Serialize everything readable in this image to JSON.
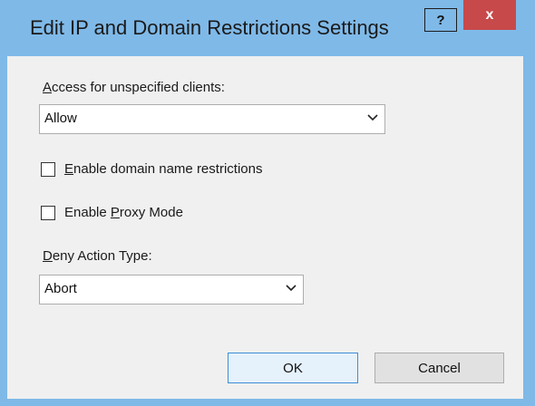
{
  "window": {
    "title": "Edit IP and Domain Restrictions Settings",
    "help_label": "?",
    "close_label": "x",
    "frame_color": "#7fb9e8",
    "close_color": "#c7494a"
  },
  "access": {
    "label_accel": "A",
    "label_rest": "ccess for unspecified clients:",
    "selected": "Allow"
  },
  "domain_restrictions": {
    "label_accel": "E",
    "label_rest": "nable domain name restrictions",
    "checked": false
  },
  "proxy_mode": {
    "label_pre": "Enable ",
    "label_accel": "P",
    "label_rest": "roxy Mode",
    "checked": false
  },
  "deny_action": {
    "label_accel": "D",
    "label_rest": "eny Action Type:",
    "selected": "Abort"
  },
  "buttons": {
    "ok": "OK",
    "cancel": "Cancel"
  }
}
